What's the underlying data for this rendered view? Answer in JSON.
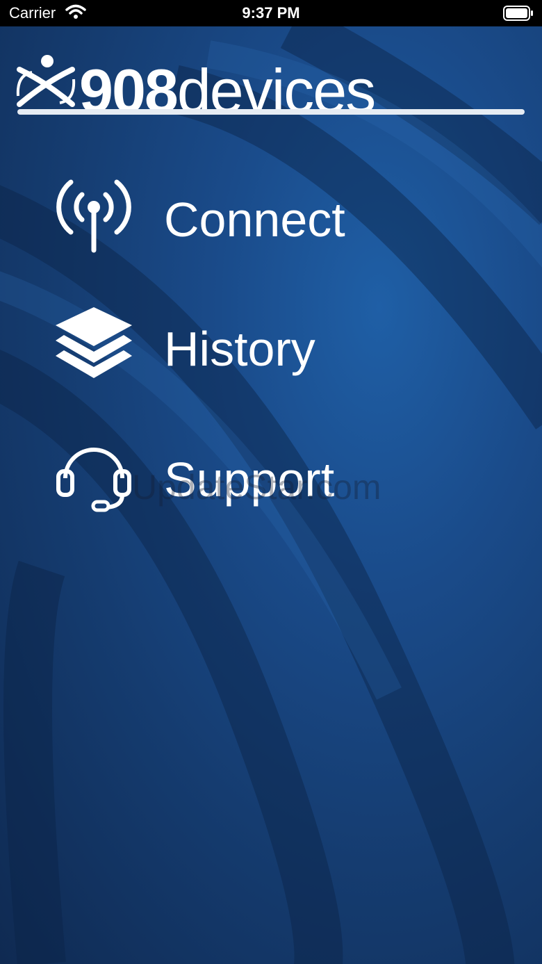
{
  "status_bar": {
    "carrier": "Carrier",
    "time": "9:37 PM"
  },
  "logo": {
    "brand_number": "908",
    "brand_word": "devices"
  },
  "menu": [
    {
      "label": "Connect",
      "icon": "antenna-signal-icon"
    },
    {
      "label": "History",
      "icon": "layers-stack-icon"
    },
    {
      "label": "Support",
      "icon": "headset-icon"
    }
  ],
  "watermark": "UpdateStar.com",
  "colors": {
    "background_top": "#1f5fa6",
    "background_bottom": "#0f2a52",
    "text": "#ffffff"
  }
}
